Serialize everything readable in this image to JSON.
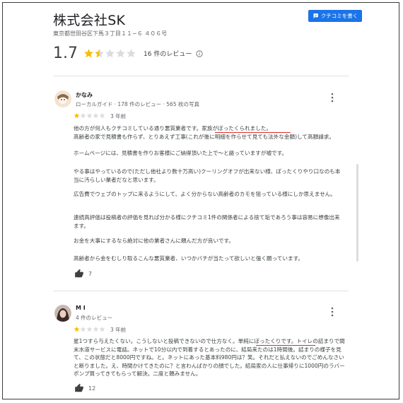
{
  "business": {
    "name": "株式会社SK",
    "address": "東京都世田谷区下馬３丁目１１−６ ４０６号",
    "rating": "1.7",
    "stars_filled": 1.5,
    "review_count": "16 件のレビュー",
    "write_review_label": "クチコミを書く"
  },
  "colors": {
    "accent": "#1a73e8",
    "star": "#fbbc04",
    "star_empty": "#dadce0",
    "underline": "#d93025"
  },
  "reviews": [
    {
      "name": "かなみ",
      "meta": "ローカルガイド · 178 件のレビュー · 565 枚の写真",
      "stars": 1,
      "date": "3 年前",
      "paragraphs": [
        "他の方が何人もクチコミしている通り悪質業者です。家族がぼったくられました。",
        "高齢者の家で見積書も作らず、とりあえず工事(これが後に明細を作らせて見ても法外な金額)して高額請求。",
        "ホームページには、見積書を作りお客様にご納得頂いた上で〜と謳っていますが嘘です。",
        "やる事はやっているので(ただし他社より数十万高い)クーリングオフが出来ない様、ぼったくりやり口なのも本当に汚らしい業者だなと思います。",
        "広告費でウェブのトップに来るようにして、よく分からない高齢者のカモを狙っている様にしか思えません。",
        "連続高評価は投稿者の評価を見れば分かる様にクチコミ1件の関係者による捨て垢であろう事は容易に想像出来ます。",
        "お金を大事にするなら絶対に他の業者さんに頼んだ方が良いです。",
        "高齢者から金をむしり取るこんな悪質業者、いつかバチが当たって欲しいと強く願っています。"
      ],
      "likes": "7"
    },
    {
      "name": "M I",
      "meta": "4 件のレビュー",
      "stars": 1,
      "date": "3 年前",
      "paragraphs": [
        "星1つすら与えたくない。こうしないと投稿できないので仕方なく。単純にぼったくりです。トイレの詰まりで間末水道サービスに電話。ネットで10分以内で到着するとあったのに、結局来たのは1時間後。詰まりの様子を見て、この状態だと8000円ですね。と。ネットにあった基本料980円は？笑。それだと払えないのでごめんなさいと断りました。え、時間かけてきたのに？と言わんばかりの顔でした。結局家の人に仕事帰りに1000円のラバーポンプ買ってきてもらって解決。二度と頼みません。"
      ],
      "likes": "12"
    }
  ]
}
